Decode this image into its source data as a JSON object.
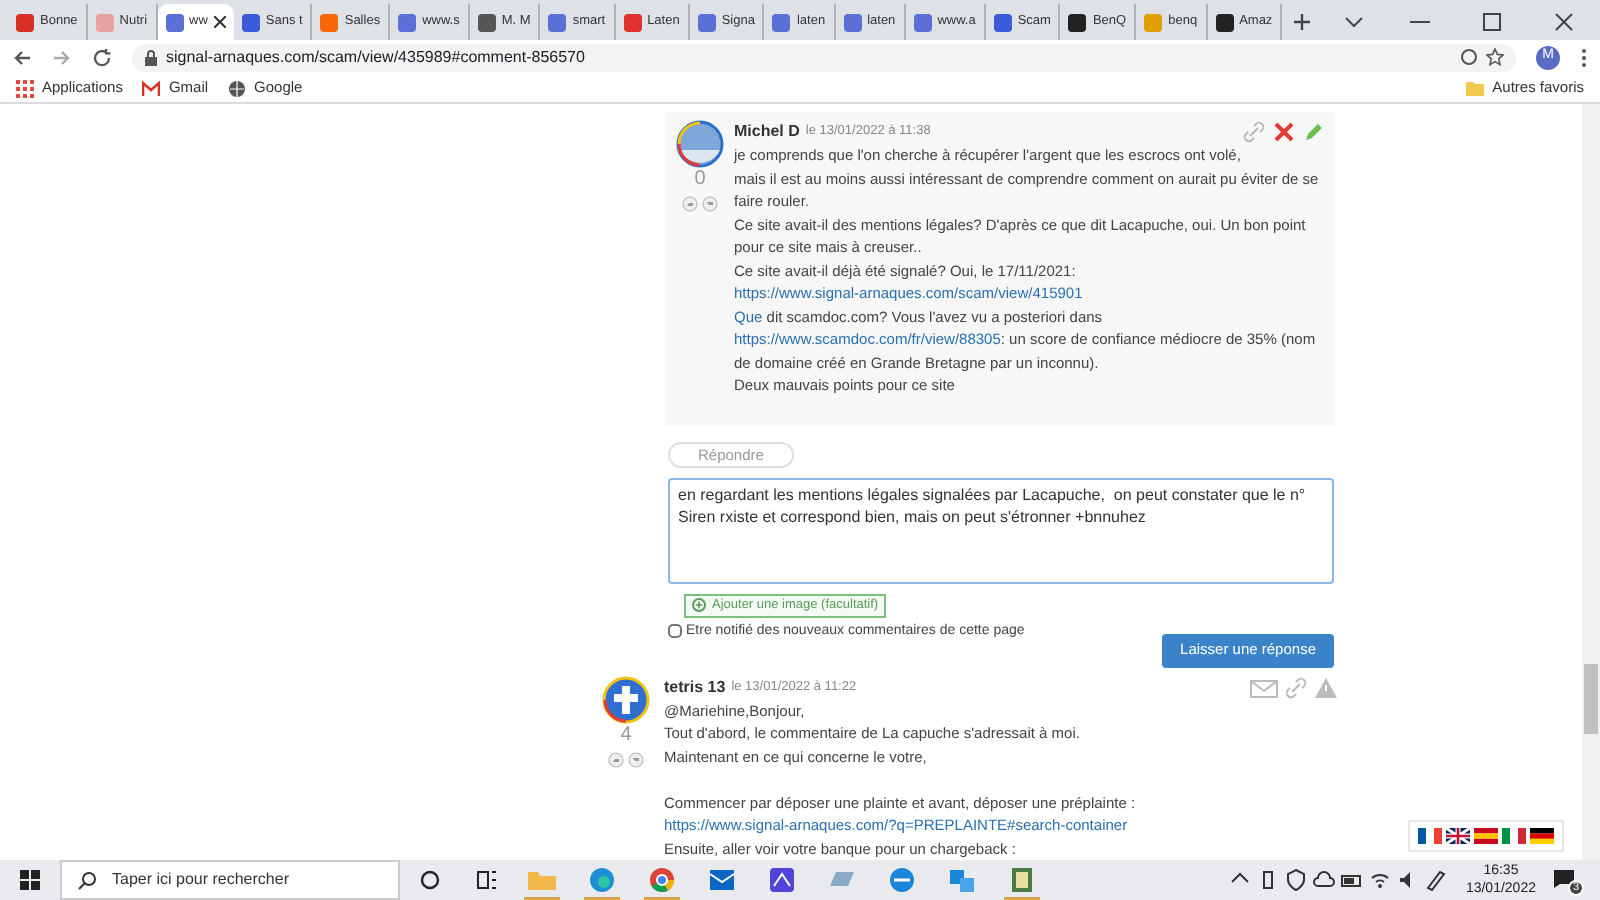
{
  "tabs": [
    {
      "label": "Bonne",
      "color": "#d93025",
      "selected": false
    },
    {
      "label": "Nutri",
      "color": "#e8a0a0",
      "selected": false
    },
    {
      "label": "ww",
      "color": "#5b6fd6",
      "selected": true
    },
    {
      "label": "Sans t",
      "color": "#3b5bdb",
      "selected": false
    },
    {
      "label": "Salles",
      "color": "#f76707",
      "selected": false
    },
    {
      "label": "www.s",
      "color": "#5b6fd6",
      "selected": false
    },
    {
      "label": "M. M",
      "color": "#555555",
      "selected": false
    },
    {
      "label": "smart",
      "color": "#5b6fd6",
      "selected": false
    },
    {
      "label": "Laten",
      "color": "#e03131",
      "selected": false
    },
    {
      "label": "Signa",
      "color": "#5b6fd6",
      "selected": false
    },
    {
      "label": "laten",
      "color": "#5b6fd6",
      "selected": false
    },
    {
      "label": "laten",
      "color": "#5b6fd6",
      "selected": false
    },
    {
      "label": "www.a",
      "color": "#5b6fd6",
      "selected": false
    },
    {
      "label": "Scam",
      "color": "#3b5bdb",
      "selected": false
    },
    {
      "label": "BenQ",
      "color": "#222222",
      "selected": false
    },
    {
      "label": "benq",
      "color": "#e0a000",
      "selected": false
    },
    {
      "label": "Amaz",
      "color": "#222222",
      "selected": false
    }
  ],
  "address": "signal-arnaques.com/scam/view/435989#comment-856570",
  "profile_initial": "M",
  "bookmarks": [
    "Applications",
    "Gmail",
    "Google"
  ],
  "other_bookmarks": "Autres favoris",
  "comments": [
    {
      "author": "Michel D",
      "date": "le 13/01/2022 à 11:38",
      "score": "0",
      "actions": [
        {
          "kind": "link"
        },
        {
          "kind": "delete"
        },
        {
          "kind": "edit"
        }
      ],
      "paragraphs": [
        {
          "space_before": false,
          "segments": [
            {
              "text": "je comprends que l'on cherche à récupérer l'argent que les escrocs ont volé,",
              "link": false
            }
          ]
        },
        {
          "space_before": false,
          "segments": [
            {
              "text": "mais il est au moins aussi intéressant de comprendre comment on aurait pu éviter de se faire rouler.",
              "link": false
            }
          ]
        },
        {
          "space_before": false,
          "segments": [
            {
              "text": "Ce site avait-il des mentions légales? D'après ce que dit Lacapuche, oui. Un bon point pour ce site mais à creuser..",
              "link": false
            }
          ]
        },
        {
          "space_before": false,
          "segments": [
            {
              "text": "Ce site avait-il déjà été signalé? Oui, le 17/11/2021: ",
              "link": false
            },
            {
              "text": "https://www.signal-arnaques.com/scam/view/415901",
              "link": true
            }
          ]
        },
        {
          "space_before": false,
          "segments": [
            {
              "text": "Que",
              "link": true
            },
            {
              "text": " dit scamdoc.com? Vous l'avez vu a posteriori dans",
              "link": false
            }
          ]
        },
        {
          "space_before": false,
          "segments": [
            {
              "text": "https://www.scamdoc.com/fr/view/88305",
              "link": true
            },
            {
              "text": ": un score de confiance médiocre de 35% (nom de domaine créé en Grande Bretagne par un inconnu).",
              "link": false
            }
          ]
        },
        {
          "space_before": false,
          "segments": [
            {
              "text": "Deux mauvais points pour ce site",
              "link": false
            }
          ]
        }
      ]
    },
    {
      "author": "tetris 13",
      "date": "le 13/01/2022 à 11:22",
      "score": "4",
      "actions": [
        {
          "kind": "mail"
        },
        {
          "kind": "link"
        },
        {
          "kind": "report"
        }
      ],
      "paragraphs": [
        {
          "space_before": false,
          "segments": [
            {
              "text": "@Mariehine,Bonjour,",
              "link": false
            }
          ]
        },
        {
          "space_before": false,
          "segments": [
            {
              "text": "Tout d'abord, le commentaire de La capuche s'adressait à moi.",
              "link": false
            }
          ]
        },
        {
          "space_before": false,
          "segments": [
            {
              "text": "Maintenant en ce qui concerne le votre,",
              "link": false
            }
          ]
        },
        {
          "space_before": true,
          "segments": [
            {
              "text": "Commencer par déposer une plainte et avant, déposer une préplainte :",
              "link": false
            }
          ]
        },
        {
          "space_before": false,
          "segments": [
            {
              "text": "https://www.signal-arnaques.com/?q=PREPLAINTE#search-container",
              "link": true
            }
          ]
        },
        {
          "space_before": false,
          "segments": [
            {
              "text": "Ensuite, aller voir votre banque pour un chargeback :",
              "link": false
            }
          ]
        }
      ]
    }
  ],
  "reply_button": "Répondre",
  "reply_text": "en regardant les mentions légales signalées par Lacapuche,  on peut constater que le n° Siren rxiste et correspond bien, mais on peut s'étronner +bnnuhez",
  "add_image": "Ajouter une image (facultatif)",
  "notify": {
    "label": "Etre notifié des nouveaux commentaires de cette page",
    "checked": false
  },
  "submit": "Laisser une réponse",
  "flags": [
    {
      "kind": "french"
    },
    {
      "kind": "british"
    },
    {
      "kind": "spanish"
    },
    {
      "kind": "italian"
    },
    {
      "kind": "german"
    }
  ],
  "taskbar": {
    "search": "Taper ici pour rechercher",
    "time": "16:35",
    "date": "13/01/2022",
    "notifications": "3"
  }
}
